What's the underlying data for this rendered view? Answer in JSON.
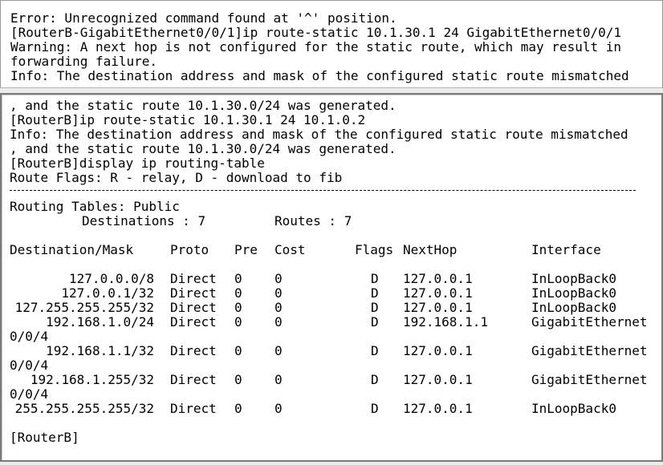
{
  "upper_pane": {
    "lines": [
      "Error: Unrecognized command found at '^' position.",
      "[RouterB-GigabitEthernet0/0/1]ip route-static 10.1.30.1 24 GigabitEthernet0/0/1",
      "Warning: A next hop is not configured for the static route, which may result in",
      "forwarding failure.",
      "Info: The destination address and mask of the configured static route mismatched"
    ]
  },
  "lower_pane": {
    "lines": [
      ", and the static route 10.1.30.0/24 was generated.",
      "[RouterB]ip route-static 10.1.30.1 24 10.1.0.2",
      "Info: The destination address and mask of the configured static route mismatched",
      ", and the static route 10.1.30.0/24 was generated.",
      "[RouterB]display ip routing-table",
      "Route Flags: R - relay, D - download to fib"
    ],
    "routing_tables_label": "Routing Tables: Public",
    "destinations_label": "Destinations : 7",
    "routes_label": "Routes : 7",
    "columns": {
      "destination_mask": "Destination/Mask",
      "proto": "Proto",
      "pre": "Pre",
      "cost": "Cost",
      "flags": "Flags",
      "nexthop": "NextHop",
      "interface": "Interface"
    },
    "routes": [
      {
        "dest": "127.0.0.0/8",
        "proto": "Direct",
        "pre": "0",
        "cost": "0",
        "flags": "D",
        "nexthop": "127.0.0.1",
        "iface": "InLoopBack0",
        "iface_wrap": ""
      },
      {
        "dest": "127.0.0.1/32",
        "proto": "Direct",
        "pre": "0",
        "cost": "0",
        "flags": "D",
        "nexthop": "127.0.0.1",
        "iface": "InLoopBack0",
        "iface_wrap": ""
      },
      {
        "dest": "127.255.255.255/32",
        "proto": "Direct",
        "pre": "0",
        "cost": "0",
        "flags": "D",
        "nexthop": "127.0.0.1",
        "iface": "InLoopBack0",
        "iface_wrap": ""
      },
      {
        "dest": "192.168.1.0/24",
        "proto": "Direct",
        "pre": "0",
        "cost": "0",
        "flags": "D",
        "nexthop": "192.168.1.1",
        "iface": "GigabitEthernet",
        "iface_wrap": "0/0/4"
      },
      {
        "dest": "192.168.1.1/32",
        "proto": "Direct",
        "pre": "0",
        "cost": "0",
        "flags": "D",
        "nexthop": "127.0.0.1",
        "iface": "GigabitEthernet",
        "iface_wrap": "0/0/4"
      },
      {
        "dest": "192.168.1.255/32",
        "proto": "Direct",
        "pre": "0",
        "cost": "0",
        "flags": "D",
        "nexthop": "127.0.0.1",
        "iface": "GigabitEthernet",
        "iface_wrap": "0/0/4"
      },
      {
        "dest": "255.255.255.255/32",
        "proto": "Direct",
        "pre": "0",
        "cost": "0",
        "flags": "D",
        "nexthop": "127.0.0.1",
        "iface": "InLoopBack0",
        "iface_wrap": ""
      }
    ],
    "prompt": "[RouterB]"
  }
}
